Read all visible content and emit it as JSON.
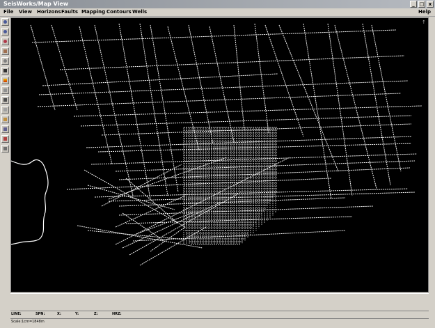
{
  "window": {
    "title": "SeisWorks/Map View",
    "minimize": "_",
    "maximize": "□",
    "close": "x"
  },
  "menu": {
    "items": [
      "File",
      "View",
      "Horizons",
      "Faults",
      "Mapping",
      "Contours",
      "Wells"
    ],
    "help": "Help"
  },
  "toolbar": {
    "tools": [
      "zoom-in-icon",
      "zoom-out-icon",
      "zoom-reset-icon",
      "palette-icon",
      "settings-icon",
      "line-select-icon",
      "color-bar-icon",
      "layers-icon",
      "fault-icon",
      "grid-icon",
      "pick-icon",
      "annotate-icon",
      "edit-icon",
      "print-icon"
    ]
  },
  "status": {
    "line": "LINE:",
    "spn": "SPN:",
    "x": "X:",
    "y": "Y:",
    "z": "Z:",
    "hrz": "HRZ:"
  },
  "scale": {
    "text": "Scale:1cm=1848m"
  },
  "colors": {
    "map_bg": "#000000",
    "lines": "#f2f2f2",
    "coast": "#ffffff",
    "chrome": "#d4d0c8"
  }
}
